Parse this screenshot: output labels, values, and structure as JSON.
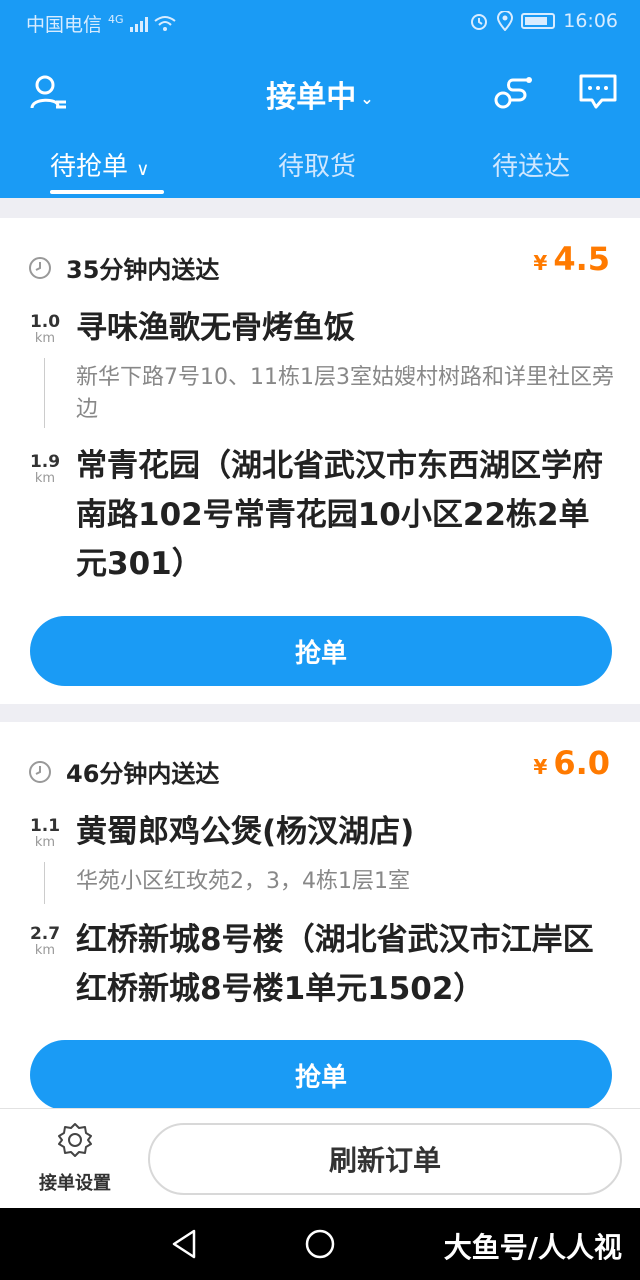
{
  "status_bar": {
    "carrier": "中国电信",
    "network": "4G",
    "time": "16:06"
  },
  "header": {
    "title": "接单中",
    "profile_icon": "user-menu-icon",
    "route_icon": "route-icon",
    "message_icon": "message-icon"
  },
  "tabs": [
    {
      "label": "待抢单",
      "active": true
    },
    {
      "label": "待取货",
      "active": false
    },
    {
      "label": "待送达",
      "active": false
    }
  ],
  "orders": [
    {
      "eta": "35分钟内送达",
      "currency": "¥",
      "price": "4.5",
      "shop_distance": "1.0",
      "shop_unit": "km",
      "shop_name": "寻味渔歌无骨烤鱼饭",
      "shop_address": "新华下路7号10、11栋1层3室姑嫂村树路和详里社区旁边",
      "dest_distance": "1.9",
      "dest_unit": "km",
      "dest_address": "常青花园（湖北省武汉市东西湖区学府南路102号常青花园10小区22栋2单元301）",
      "button": "抢单"
    },
    {
      "eta": "46分钟内送达",
      "currency": "¥",
      "price": "6.0",
      "shop_distance": "1.1",
      "shop_unit": "km",
      "shop_name": "黄蜀郎鸡公煲(杨汊湖店)",
      "shop_address": "华苑小区红玫苑2，3，4栋1层1室",
      "dest_distance": "2.7",
      "dest_unit": "km",
      "dest_address": "红桥新城8号楼（湖北省武汉市江岸区红桥新城8号楼1单元1502）",
      "button": "抢单"
    }
  ],
  "bottom": {
    "settings_label": "接单设置",
    "refresh_label": "刷新订单"
  },
  "watermark": "大鱼号/人人视",
  "colors": {
    "primary": "#1a9bf5",
    "price": "#ff7a00"
  }
}
